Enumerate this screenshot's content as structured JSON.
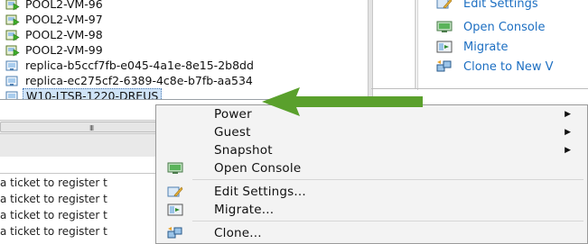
{
  "inventory": {
    "items": [
      {
        "label": "POOL2-VM-96",
        "icon": "vm-powered-on-icon"
      },
      {
        "label": "POOL2-VM-97",
        "icon": "vm-powered-on-icon"
      },
      {
        "label": "POOL2-VM-98",
        "icon": "vm-powered-on-icon"
      },
      {
        "label": "POOL2-VM-99",
        "icon": "vm-powered-on-icon"
      },
      {
        "label": "replica-b5ccf7fb-e045-4a1e-8e15-2b8dd",
        "icon": "vm-replica-icon"
      },
      {
        "label": "replica-ec275cf2-6389-4c8e-b7fb-aa534",
        "icon": "vm-replica-icon"
      },
      {
        "label": "W10-LTSB-1220-DREUS",
        "icon": "vm-replica-icon",
        "selected": true
      }
    ],
    "scroll_grip": "III"
  },
  "recent_tasks": [
    "a ticket to register t",
    "a ticket to register t",
    "a ticket to register t",
    "a ticket to register t"
  ],
  "actions_panel": {
    "items": [
      {
        "label": "Edit Settings",
        "icon": "edit-settings-icon"
      },
      {
        "label": "Open Console",
        "icon": "console-icon"
      },
      {
        "label": "Migrate",
        "icon": "migrate-icon"
      },
      {
        "label": "Clone to New V",
        "icon": "clone-icon"
      }
    ]
  },
  "context_menu": {
    "items": [
      {
        "label": "Power",
        "submenu": true
      },
      {
        "label": "Guest",
        "submenu": true
      },
      {
        "label": "Snapshot",
        "submenu": true
      },
      {
        "label": "Open Console",
        "icon": "console-icon"
      },
      {
        "label": "Edit Settings...",
        "icon": "edit-settings-icon"
      },
      {
        "label": "Migrate...",
        "icon": "migrate-icon"
      },
      {
        "label": "Clone...",
        "icon": "clone-icon"
      }
    ],
    "submenu_arrow": "▶"
  },
  "colors": {
    "link": "#1d6fc2",
    "arrow": "#5aa02c",
    "selection": "#cfe3f7"
  }
}
